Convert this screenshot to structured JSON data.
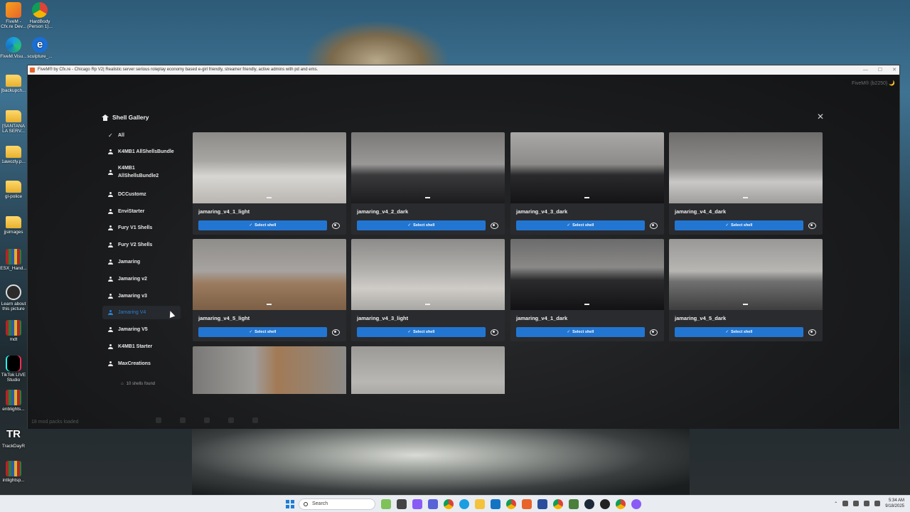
{
  "desktop": {
    "icons": [
      {
        "label": "FiveM - Cfx.re Dev...",
        "icon": "fivem-icon"
      },
      {
        "label": "HardBody (Person 1)...",
        "icon": "chrome-icon"
      },
      {
        "label": "FiveM.Visu...",
        "icon": "edge-icon"
      },
      {
        "label": "sculpture_...",
        "icon": "ie-icon"
      },
      {
        "label": "[backupch...",
        "icon": "folder-icon"
      },
      {
        "label": "[SANTANA LA SERV...",
        "icon": "folder-icon"
      },
      {
        "label": "1awozly.p...",
        "icon": "folder-icon"
      },
      {
        "label": "gl-police",
        "icon": "folder-icon"
      },
      {
        "label": "jjsimages",
        "icon": "folder-icon"
      },
      {
        "label": "ESX_Hand...",
        "icon": "winrar-icon"
      },
      {
        "label": "Learn about this picture",
        "icon": "learn-icon"
      },
      {
        "label": "mdt",
        "icon": "winrar-icon"
      },
      {
        "label": "TikTok LIVE Studio",
        "icon": "tiktok-icon"
      },
      {
        "label": "enblights...",
        "icon": "winrar-icon"
      },
      {
        "label": "TrackDayR",
        "icon": "trackday-icon"
      },
      {
        "label": "intlightsp...",
        "icon": "winrar-icon"
      }
    ]
  },
  "window": {
    "title": "FiveM® by Cfx.re - Chicago Rp V2| Realistic server serious roleplay economy based e-girl friendly, streamer friendly, active admins with pd and ems.",
    "controls": [
      "—",
      "☐",
      "✕"
    ],
    "brand_tag": "FiveM® (b2250) 🌙",
    "mod_status": "18 mod packs loaded"
  },
  "gallery": {
    "title": "Shell Gallery",
    "close": "✕",
    "count_text": "10 shells found",
    "categories": [
      {
        "label": "All",
        "icon": "check-icon",
        "active": false
      },
      {
        "label": "K4MB1 AllShellsBundle",
        "icon": "user-icon",
        "active": false
      },
      {
        "label": "K4MB1 AllShellsBundle2",
        "icon": "user-icon",
        "active": false
      },
      {
        "label": "DCCustomz",
        "icon": "user-icon",
        "active": false
      },
      {
        "label": "EnviStarter",
        "icon": "user-icon",
        "active": false
      },
      {
        "label": "Fury V1 Shells",
        "icon": "user-icon",
        "active": false
      },
      {
        "label": "Fury V2 Shells",
        "icon": "user-icon",
        "active": false
      },
      {
        "label": "Jamaring",
        "icon": "user-icon",
        "active": false
      },
      {
        "label": "Jamaring v2",
        "icon": "user-icon",
        "active": false
      },
      {
        "label": "Jamaring v3",
        "icon": "user-icon",
        "active": false
      },
      {
        "label": "Jamaring V4",
        "icon": "user-icon",
        "active": true
      },
      {
        "label": "Jamaring V5",
        "icon": "user-icon",
        "active": false
      },
      {
        "label": "K4MB1 Starter",
        "icon": "user-icon",
        "active": false
      },
      {
        "label": "MaxCreations",
        "icon": "user-icon",
        "active": false
      }
    ],
    "select_label": "Select shell",
    "shells": [
      {
        "name": "jamaring_v4_1_light"
      },
      {
        "name": "jamaring_v4_2_dark"
      },
      {
        "name": "jamaring_v4_3_dark"
      },
      {
        "name": "jamaring_v4_4_dark"
      },
      {
        "name": "jamaring_v4_5_light"
      },
      {
        "name": "jamaring_v4_3_light"
      },
      {
        "name": "jamaring_v4_1_dark"
      },
      {
        "name": "jamaring_v4_5_dark"
      },
      {
        "name": ""
      },
      {
        "name": ""
      }
    ]
  },
  "taskbar": {
    "search_placeholder": "Search",
    "time": "5:34 AM",
    "date": "9/18/2025"
  }
}
